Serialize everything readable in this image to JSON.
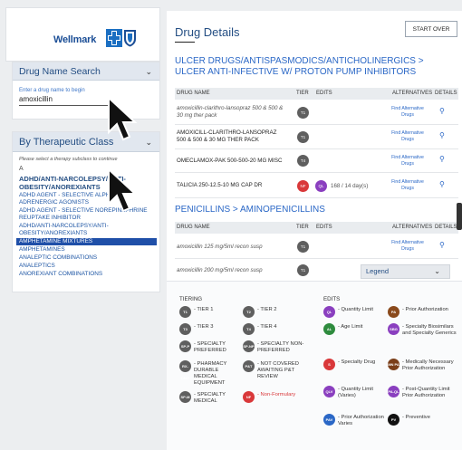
{
  "brand": {
    "name": "Wellmark"
  },
  "colors": {
    "accent": "#244e83",
    "link": "#2a67c6",
    "selected": "#1f4fa8",
    "nonformulary": "#d9383a",
    "quantity_limit": "#8a3fbf"
  },
  "search_panel": {
    "title": "Drug Name Search",
    "input_label": "Enter a drug name to begin",
    "input_value": "amoxicillin"
  },
  "class_panel": {
    "title": "By Therapeutic Class",
    "hint": "Please select a therapy subclass to continue",
    "letter": "A",
    "items": [
      {
        "label": "ADHD/ANTI-NARCOLEPSY/ANTI-OBESITY/ANOREXIANTS",
        "type": "big"
      },
      {
        "label": "ADHD AGENT - SELECTIVE ALPHA-2 ADRENERGIC AGONISTS",
        "type": "normal"
      },
      {
        "label": "ADHD AGENT - SELECTIVE NOREPINEPHRINE REUPTAKE INHIBITOR",
        "type": "normal"
      },
      {
        "label": "ADHD/ANTI-NARCOLEPSY/ANTI-OBESITY/ANOREXIANTS",
        "type": "normal"
      },
      {
        "label": "AMPHETAMINE MIXTURES",
        "type": "selected"
      },
      {
        "label": "AMPHETAMINES",
        "type": "normal"
      },
      {
        "label": "ANALEPTIC COMBINATIONS",
        "type": "normal"
      },
      {
        "label": "ANALEPTICS",
        "type": "normal"
      },
      {
        "label": "ANOREXIANT COMBINATIONS",
        "type": "normal"
      }
    ]
  },
  "main": {
    "title": "Drug Details",
    "start_over": "START OVER",
    "columns": {
      "drug_name": "DRUG NAME",
      "tier": "TIER",
      "edits": "EDITS",
      "alternatives": "ALTERNATIVES",
      "details": "DETAILS"
    },
    "sections": [
      {
        "title": "ULCER DRUGS/ANTISPASMODICS/ANTICHOLINERGICS > ULCER ANTI-INFECTIVE W/ PROTON PUMP INHIBITORS",
        "rows": [
          {
            "name": "amoxicillin-clarithro-lansopraz 500 & 500 & 30 mg ther pack",
            "italic": true,
            "tier": "T1",
            "edit_badge": "",
            "edit_text": "",
            "alt": "Find Alternative Drugs"
          },
          {
            "name": "AMOXICILL-CLARITHRO-LANSOPRAZ 500 & 500 & 30 MG THER PACK",
            "italic": false,
            "tier": "T1",
            "edit_badge": "",
            "edit_text": "",
            "alt": "Find Alternative Drugs"
          },
          {
            "name": "OMECLAMOX-PAK 500-500-20 MG MISC",
            "italic": false,
            "tier": "T4",
            "edit_badge": "",
            "edit_text": "",
            "alt": "Find Alternative Drugs"
          },
          {
            "name": "TALICIA 250-12.5-10 MG CAP DR",
            "italic": false,
            "tier": "NF",
            "edit_badge": "QL",
            "edit_text": "168 / 14 day(s)",
            "alt": "Find Alternative Drugs"
          }
        ]
      },
      {
        "title": "PENICILLINS > AMINOPENICILLINS",
        "rows": [
          {
            "name": "amoxicillin 125 mg/5ml recon susp",
            "italic": true,
            "tier": "T1",
            "edit_badge": "",
            "edit_text": "",
            "alt": "Find Alternative Drugs"
          },
          {
            "name": "amoxicillin 200 mg/5ml recon susp",
            "italic": true,
            "tier": "T1",
            "edit_badge": "",
            "edit_text": "",
            "alt": ""
          }
        ]
      }
    ]
  },
  "legend": {
    "dropdown_label": "Legend",
    "tiering_title": "TIERING",
    "edits_title": "EDITS",
    "tiering": [
      {
        "badge": "T1",
        "label": "- TIER 1",
        "color": "#5f5f5f"
      },
      {
        "badge": "T2",
        "label": "- TIER 2",
        "color": "#5f5f5f"
      },
      {
        "badge": "T3",
        "label": "- TIER 3",
        "color": "#5f5f5f"
      },
      {
        "badge": "T4",
        "label": "- TIER 4",
        "color": "#5f5f5f"
      },
      {
        "badge": "SP-P",
        "label": "- SPECIALTY PREFERRED",
        "color": "#5f5f5f"
      },
      {
        "badge": "SP-NP",
        "label": "- SPECIALTY NON-PREFERRED",
        "color": "#5f5f5f"
      },
      {
        "badge": "RX-DME",
        "label": "- PHARMACY DURABLE MEDICAL EQUIPMENT",
        "color": "#5f5f5f"
      },
      {
        "badge": "P&T",
        "label": "- NOT COVERED AWAITING P&T REVIEW",
        "color": "#5f5f5f"
      },
      {
        "badge": "SP-M",
        "label": "- SPECIALTY MEDICAL",
        "color": "#5f5f5f"
      },
      {
        "badge": "NF",
        "label": "- Non-Formulary",
        "color": "#d9383a"
      }
    ],
    "edits": [
      {
        "badge": "QL",
        "label": "- Quantity Limit",
        "color": "#8a3fbf"
      },
      {
        "badge": "PA",
        "label": "- Prior Authorization",
        "color": "#8a4a1c"
      },
      {
        "badge": "AL",
        "label": "- Age Limit",
        "color": "#2e8b3e"
      },
      {
        "badge": "SBG",
        "label": "- Specialty Biosimilars and Specialty Generics",
        "color": "#8a3fbf"
      },
      {
        "badge": "S",
        "label": "- Specialty Drug",
        "color": "#d9383a"
      },
      {
        "badge": "MN PA",
        "label": "- Medically Necessary Prior Authorization",
        "color": "#7b3f1a"
      },
      {
        "badge": "QLV",
        "label": "- Quantity Limit (Varies)",
        "color": "#8a3fbf"
      },
      {
        "badge": "PA-QL",
        "label": "- Post-Quantity Limit Prior Authorization",
        "color": "#8a3fbf"
      },
      {
        "badge": "PAV",
        "label": "- Prior Authorization Varies",
        "color": "#2a67c6"
      },
      {
        "badge": "PV",
        "label": "- Preventive",
        "color": "#111111"
      }
    ]
  }
}
